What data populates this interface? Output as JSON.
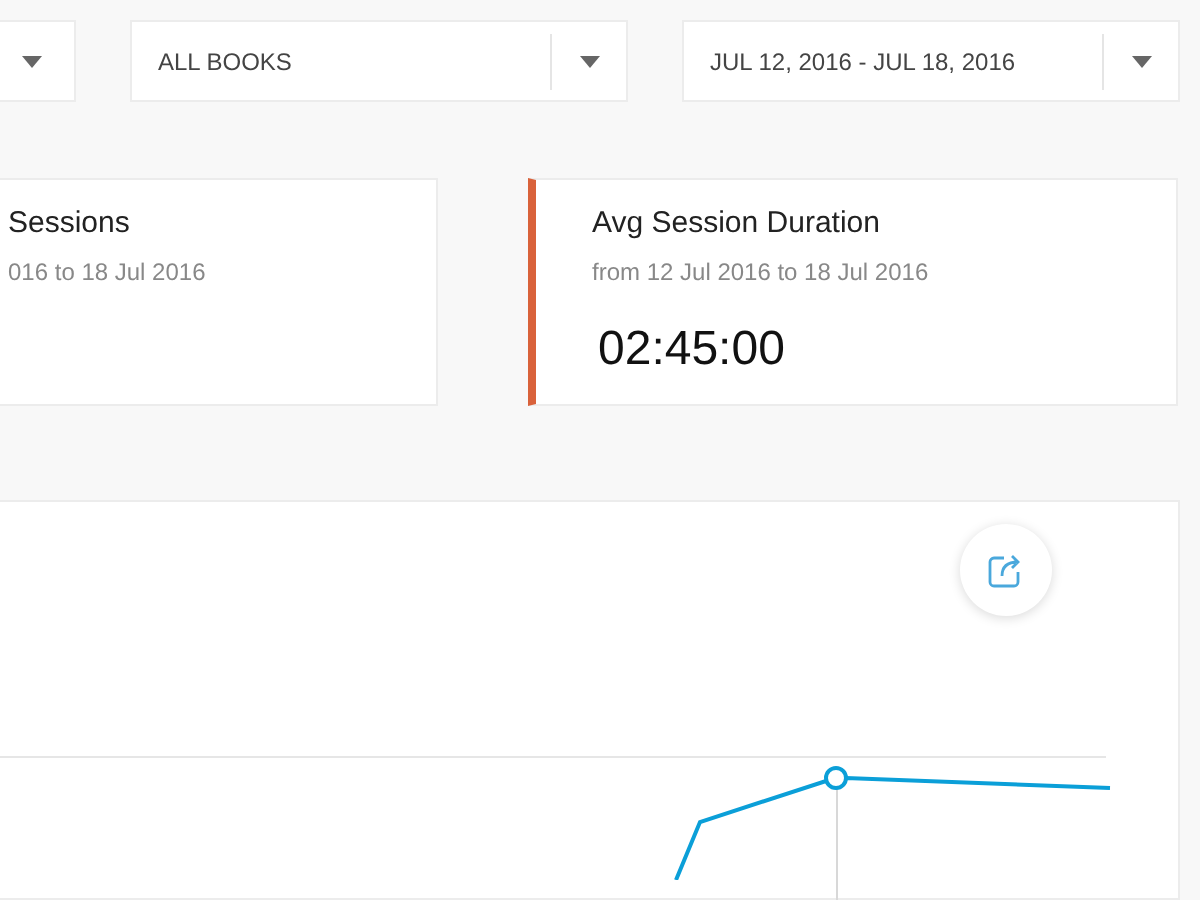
{
  "filters": [
    {
      "value": "ALL BOOKS"
    },
    {
      "value": "JUL 12, 2016 - JUL 18, 2016"
    }
  ],
  "cards": [
    {
      "title": "Sessions",
      "subtitle": "016 to 18 Jul 2016",
      "highlighted": false
    },
    {
      "title": "Avg Session Duration",
      "subtitle": "from 12 Jul 2016 to 18 Jul 2016",
      "value": "02:45:00",
      "highlighted": true
    }
  ]
}
